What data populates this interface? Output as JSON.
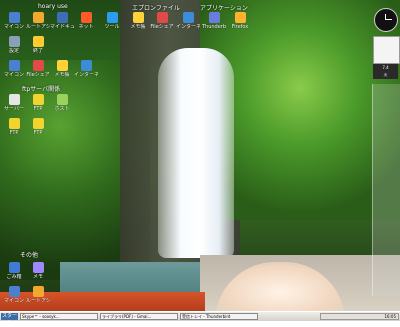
{
  "desktop": {
    "groups": [
      "hoary use",
      "ftpサーバ関係",
      "その他"
    ],
    "top_banner_labels": [
      "エプロンファイル",
      "アプリケーション"
    ],
    "icons": [
      {
        "label": "マイコン",
        "color": "#4a7fd1"
      },
      {
        "label": "ルートアシスト",
        "color": "#f2a72e"
      },
      {
        "label": "マイドキュメント",
        "color": "#3c6db5"
      },
      {
        "label": "ネット",
        "color": "#ff5a2a"
      },
      {
        "label": "ツール",
        "color": "#2b9cf0"
      },
      {
        "label": "メモ帳",
        "color": "#ffd23a"
      },
      {
        "label": "Fileシェア",
        "color": "#e24a4a"
      },
      {
        "label": "インターネット",
        "color": "#3d8cd8"
      },
      {
        "label": "Thunderbird",
        "color": "#6a7ddc"
      },
      {
        "label": "Firefox",
        "color": "#ffb12f"
      },
      {
        "label": "設定",
        "color": "#8aa0b9"
      },
      {
        "label": "終了",
        "color": "#ffcc2f"
      }
    ],
    "ftp_icons": [
      {
        "label": "サーバー",
        "color": "#e6e6e6"
      },
      {
        "label": "FTP",
        "color": "#f1d52e"
      },
      {
        "label": "ホスト",
        "color": "#9bd15e"
      }
    ],
    "bottom_icons": [
      {
        "label": "ごみ箱",
        "color": "#3f7ad6"
      },
      {
        "label": "メモ",
        "color": "#9d88ff"
      }
    ]
  },
  "side": {
    "date": "7.4",
    "weekday": "火"
  },
  "taskbar": {
    "start_label": "スタート",
    "tasks": [
      "Skype™ - soosyk...",
      "ライブラリ(PDF) - Gmai...",
      "受信トレイ - Thunderbird"
    ],
    "time": "16:05"
  }
}
